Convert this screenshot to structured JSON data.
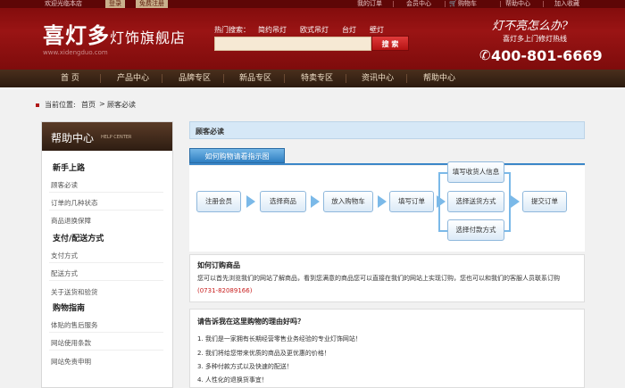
{
  "topbar": {
    "welcome": "欢迎光临本店",
    "login": "登录",
    "register": "免费注册",
    "my_orders": "我的订单",
    "member_center": "会员中心",
    "cart": "购物车",
    "help_center": "帮助中心",
    "favorites": "加入收藏"
  },
  "header": {
    "logo_main": "喜灯多",
    "logo_suffix": "灯饰旗舰店",
    "logo_url": "www.xidengduo.com",
    "hot_label": "热门搜索：",
    "hot_links": [
      "简约吊灯",
      "欧式吊灯",
      "台灯",
      "壁灯"
    ],
    "search_value": "",
    "search_button": "搜 索",
    "slogan": "灯不亮怎么办?",
    "slogan_sub": "喜灯多上门修灯热线",
    "phone": "400-801-6669",
    "colors": {
      "brand_red": "#8c0f0f",
      "nav_brown": "#3a2414",
      "accent_blue": "#3a86c8"
    }
  },
  "nav": [
    "首 页",
    "产品中心",
    "品牌专区",
    "新品专区",
    "特卖专区",
    "资讯中心",
    "帮助中心"
  ],
  "breadcrumb": {
    "label": "当前位置:",
    "home": "首页",
    "arrow": ">",
    "current": "顾客必读"
  },
  "sidebar": {
    "title": "帮助中心",
    "title_en": "HELP CENTER",
    "sections": [
      {
        "title": "新手上路",
        "links": [
          "顾客必读",
          "订单的几种状态",
          "商品退换保障"
        ]
      },
      {
        "title": "支付/配送方式",
        "links": [
          "支付方式",
          "配送方式",
          "关于送货和验货"
        ]
      },
      {
        "title": "购物指南",
        "links": [
          "体贴的售后服务",
          "网站使用条款",
          "网站免责申明"
        ]
      }
    ]
  },
  "main": {
    "title": "顾客必读",
    "how_tab": "如何购物请看指示图",
    "flow": [
      "注册会员",
      "选择商品",
      "放入购物车",
      "填写订单",
      "填写收货人信息",
      "选择送货方式",
      "选择付款方式",
      "提交订单"
    ],
    "box1": {
      "title": "如何订购商品",
      "text": "您可以首先浏览我们的网站了解商品，看到您满意的商品您可以直接在我们的网站上实现订购，您也可以和我们的客服人员联系订购",
      "phone": "(0731-82089166)"
    },
    "box2": {
      "title": "请告诉我在这里购物的理由好吗？",
      "items": [
        "1. 我们是一家拥有长期经营零售业务经验的专业灯饰网站！",
        "2. 我们将给您带来优质的商品及更优惠的价格！",
        "3. 多种付款方式以及快速的配送！",
        "4. 人性化的退换货事宜！"
      ]
    }
  },
  "icons": [
    "cart-icon",
    "phone-icon",
    "breadcrumb-marker-icon",
    "flow-arrow-icon"
  ]
}
